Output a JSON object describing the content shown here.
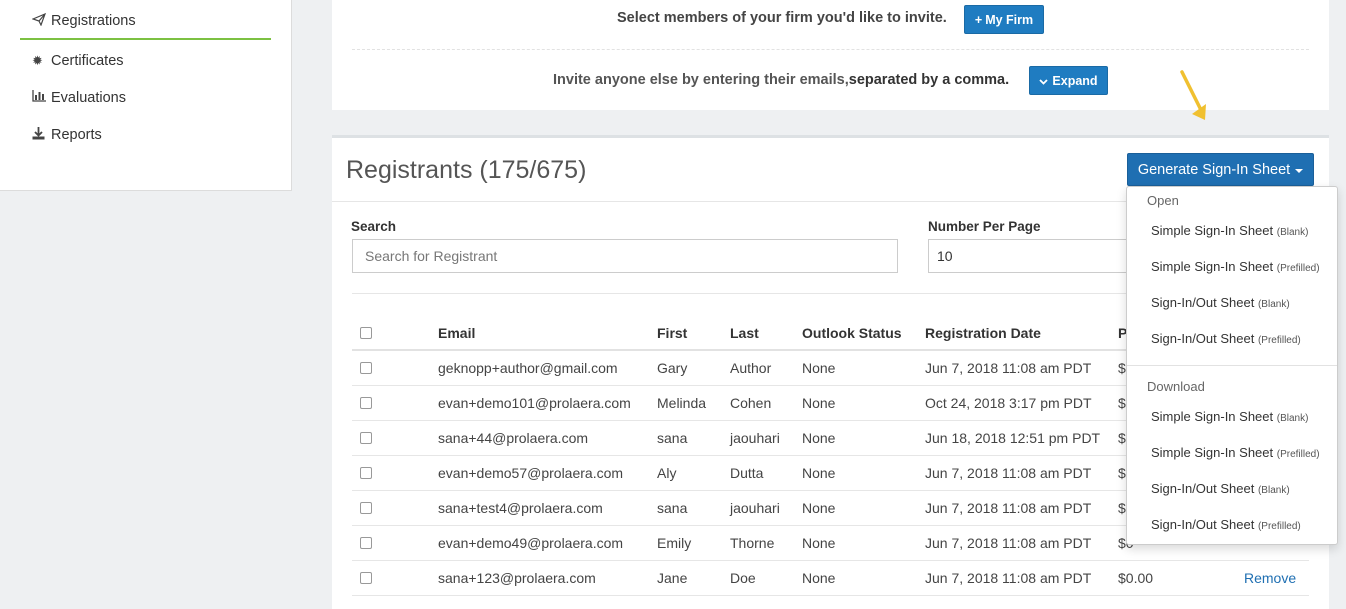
{
  "sidebar": {
    "items": [
      {
        "label": "Registrations",
        "icon": "paper-plane-icon",
        "active": true
      },
      {
        "label": "Certificates",
        "icon": "certificate-icon"
      },
      {
        "label": "Evaluations",
        "icon": "bar-chart-icon"
      },
      {
        "label": "Reports",
        "icon": "download-icon"
      }
    ]
  },
  "invite": {
    "firm_text": "Select members of your firm you'd like to invite.",
    "firm_button": "My Firm",
    "email_text_part1": "Invite anyone else by entering their emails,",
    "email_text_part2": "separated by a comma.",
    "expand_button": "Expand"
  },
  "registrants": {
    "title": "Registrants (175/675)",
    "generate_button": "Generate Sign-In Sheet",
    "search_label": "Search",
    "search_placeholder": "Search for Registrant",
    "npp_label": "Number Per Page",
    "npp_value": "10",
    "columns": {
      "email": "Email",
      "first": "First",
      "last": "Last",
      "outlook": "Outlook Status",
      "date": "Registration Date",
      "price": "P"
    },
    "rows": [
      {
        "email": "geknopp+author@gmail.com",
        "first": "Gary",
        "last": "Author",
        "outlook": "None",
        "date": "Jun 7, 2018 11:08 am PDT",
        "price": "$0",
        "remove": ""
      },
      {
        "email": "evan+demo101@prolaera.com",
        "first": "Melinda",
        "last": "Cohen",
        "outlook": "None",
        "date": "Oct 24, 2018 3:17 pm PDT",
        "price": "$0",
        "remove": ""
      },
      {
        "email": "sana+44@prolaera.com",
        "first": "sana",
        "last": "jaouhari",
        "outlook": "None",
        "date": "Jun 18, 2018 12:51 pm PDT",
        "price": "$0",
        "remove": ""
      },
      {
        "email": "evan+demo57@prolaera.com",
        "first": "Aly",
        "last": "Dutta",
        "outlook": "None",
        "date": "Jun 7, 2018 11:08 am PDT",
        "price": "$0",
        "remove": ""
      },
      {
        "email": "sana+test4@prolaera.com",
        "first": "sana",
        "last": "jaouhari",
        "outlook": "None",
        "date": "Jun 7, 2018 11:08 am PDT",
        "price": "$0",
        "remove": ""
      },
      {
        "email": "evan+demo49@prolaera.com",
        "first": "Emily",
        "last": "Thorne",
        "outlook": "None",
        "date": "Jun 7, 2018 11:08 am PDT",
        "price": "$0",
        "remove": ""
      },
      {
        "email": "sana+123@prolaera.com",
        "first": "Jane",
        "last": "Doe",
        "outlook": "None",
        "date": "Jun 7, 2018 11:08 am PDT",
        "price": "$0.00",
        "remove": "Remove"
      }
    ]
  },
  "dropdown": {
    "open_header": "Open",
    "download_header": "Download",
    "open_items": [
      {
        "label": "Simple Sign-In Sheet",
        "note": "(Blank)"
      },
      {
        "label": "Simple Sign-In Sheet",
        "note": "(Prefilled)"
      },
      {
        "label": "Sign-In/Out Sheet",
        "note": "(Blank)"
      },
      {
        "label": "Sign-In/Out Sheet",
        "note": "(Prefilled)"
      }
    ],
    "download_items": [
      {
        "label": "Simple Sign-In Sheet",
        "note": "(Blank)"
      },
      {
        "label": "Simple Sign-In Sheet",
        "note": "(Prefilled)"
      },
      {
        "label": "Sign-In/Out Sheet",
        "note": "(Blank)"
      },
      {
        "label": "Sign-In/Out Sheet",
        "note": "(Prefilled)"
      }
    ]
  },
  "colors": {
    "accent_blue": "#1f6fb2",
    "active_green": "#7cc142",
    "annotation_arrow": "#f0c030"
  }
}
